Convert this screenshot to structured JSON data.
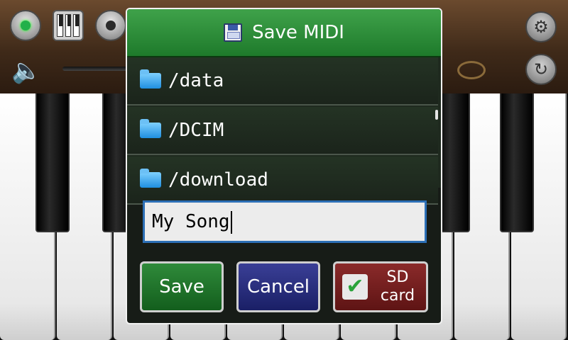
{
  "app": {
    "top_controls": {
      "record_icon": "record-dot-green",
      "piano_keys_icon": "piano-keys",
      "stop_icon": "stop-dot",
      "settings_icon": "gear",
      "refresh_icon": "refresh",
      "volume_icon": "speaker"
    }
  },
  "dialog": {
    "title": "Save MIDI",
    "title_icon": "floppy-disk",
    "folders": [
      {
        "label": "/data"
      },
      {
        "label": "/DCIM"
      },
      {
        "label": "/download"
      }
    ],
    "filename_value": "My Song",
    "buttons": {
      "save": "Save",
      "cancel": "Cancel",
      "sd_card": "SD\ncard",
      "sd_checked": true
    }
  },
  "colors": {
    "header_green": "#2e8f3a",
    "save_green": "#1f6f2a",
    "cancel_blue": "#262b7e",
    "sd_red": "#741f1f",
    "field_border": "#2c6fb6"
  }
}
